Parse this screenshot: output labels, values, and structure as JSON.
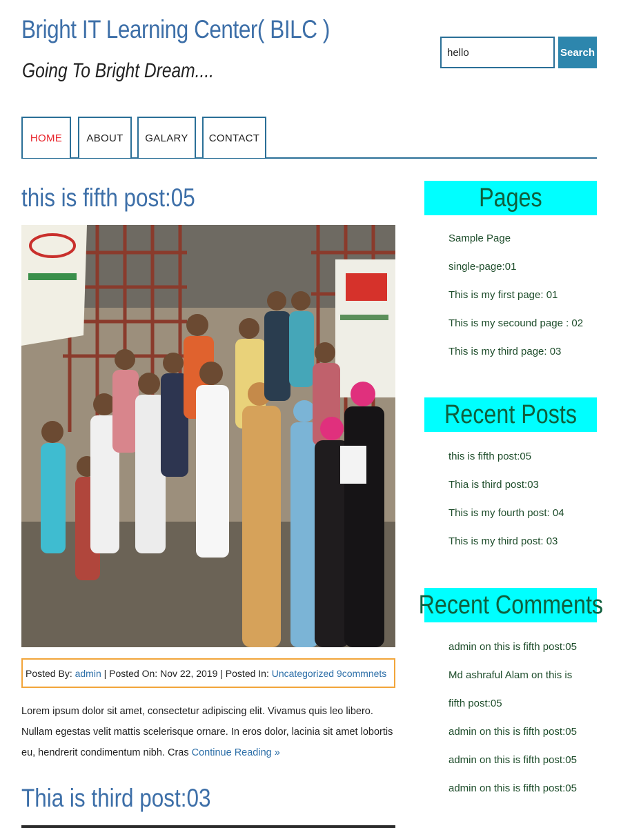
{
  "header": {
    "site_title": "Bright IT Learning Center( BILC )",
    "tagline": "Going To Bright Dream...."
  },
  "search": {
    "value": "hello",
    "button_label": "Search"
  },
  "nav": {
    "items": [
      {
        "label": "HOME",
        "active": true
      },
      {
        "label": "ABOUT"
      },
      {
        "label": "GALARY"
      },
      {
        "label": "CONTACT"
      }
    ]
  },
  "posts": [
    {
      "title": "this is fifth post:05",
      "image": "group-photo",
      "meta": {
        "posted_by_label": "Posted By:",
        "author": "admin",
        "posted_on_label": "| Posted On:",
        "date": "Nov 22, 2019",
        "posted_in_label": "| Posted In:",
        "category": "Uncategorized",
        "comments": "9commnets"
      },
      "excerpt": "Lorem ipsum dolor sit amet, consectetur adipiscing elit. Vivamus quis leo libero. Nullam egestas velit mattis scelerisque ornare. In eros dolor, lacinia sit amet lobortis eu, hendrerit condimentum nibh. Cras",
      "read_more": "Continue Reading »"
    },
    {
      "title": "Thia is third post:03"
    }
  ],
  "sidebar": {
    "pages": {
      "title": "Pages",
      "items": [
        "Sample Page",
        "single-page:01",
        "This is my first page: 01",
        "This is my secound page : 02",
        "This is my third page: 03"
      ]
    },
    "recent_posts": {
      "title": "Recent Posts",
      "items": [
        "this is fifth post:05",
        "Thia is third post:03",
        "This is my fourth post: 04",
        "This is my third post: 03"
      ]
    },
    "recent_comments": {
      "title": "Recent Comments",
      "items": [
        "admin on this is fifth post:05",
        "Md ashraful Alam on this is fifth post:05",
        "admin on this is fifth post:05",
        "admin on this is fifth post:05",
        "admin on this is fifth post:05"
      ]
    }
  },
  "colors": {
    "link": "#3d6fa8",
    "widget_bg": "#00ffff",
    "widget_title": "#0f5f3d",
    "nav_border": "#2a6f97",
    "nav_active": "#e8242b",
    "meta_border": "#f2a53a",
    "search_button": "#2d86ad"
  }
}
